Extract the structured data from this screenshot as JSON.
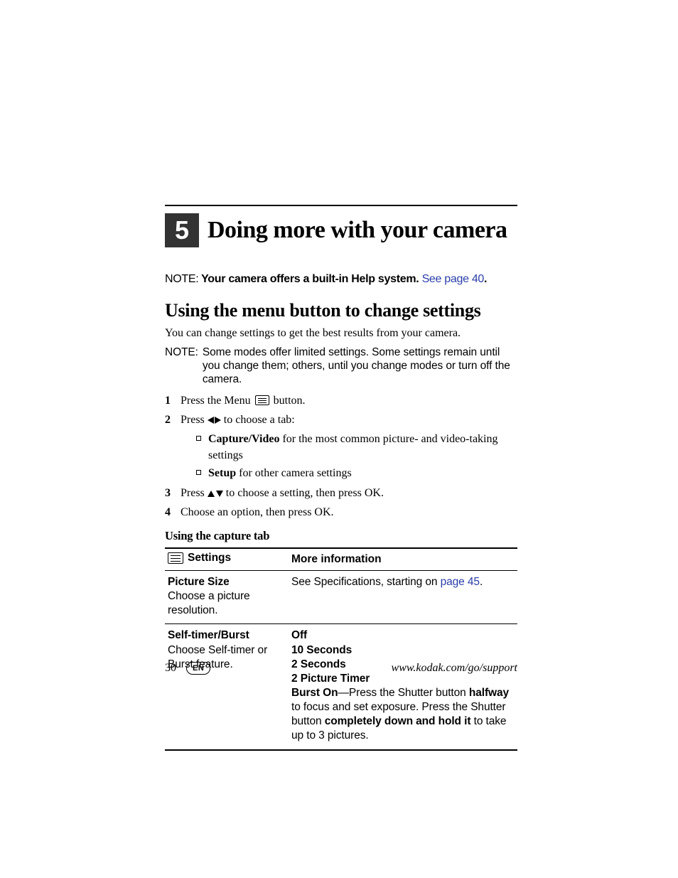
{
  "chapter": {
    "number": "5",
    "title": "Doing more with your camera"
  },
  "note1": {
    "label": "NOTE:",
    "text_before_link": "Your camera offers a built-in Help system. ",
    "link": "See page 40",
    "after_link": "."
  },
  "section_title": "Using the menu button to change settings",
  "intro": "You can change settings to get the best results from your camera.",
  "note2": {
    "label": "NOTE:",
    "text": "Some modes offer limited settings. Some settings remain until you change them; others, until you change modes or turn off the camera."
  },
  "steps": {
    "s1_a": "Press the Menu ",
    "s1_b": " button.",
    "s2_a": "Press ",
    "s2_b": " to choose a tab:",
    "bullet1_bold": "Capture/Video",
    "bullet1_rest": " for the most common picture- and video-taking settings",
    "bullet2_bold": "Setup",
    "bullet2_rest": " for other camera settings",
    "s3_a": "Press ",
    "s3_b": " to choose a setting, then press OK.",
    "s4": "Choose an option, then press OK."
  },
  "subhead": "Using the capture tab",
  "table": {
    "h1": "Settings",
    "h2": "More information",
    "r1": {
      "title": "Picture Size",
      "desc": "Choose a picture resolution.",
      "info_a": "See Specifications, starting on ",
      "info_link": "page 45",
      "info_b": "."
    },
    "r2": {
      "title": "Self-timer/Burst",
      "desc": "Choose Self-timer or Burst feature.",
      "opt1": "Off",
      "opt2": "10 Seconds",
      "opt3": "2 Seconds",
      "opt4": "2 Picture Timer",
      "burst_b1": "Burst On",
      "burst_t1": "—Press the Shutter button ",
      "burst_b2": "halfway",
      "burst_t2": " to focus and set exposure. Press the Shutter button ",
      "burst_b3": "completely down and hold it",
      "burst_t3": " to take up to 3 pictures."
    }
  },
  "footer": {
    "page": "30",
    "lang": "EN",
    "url": "www.kodak.com/go/support"
  }
}
